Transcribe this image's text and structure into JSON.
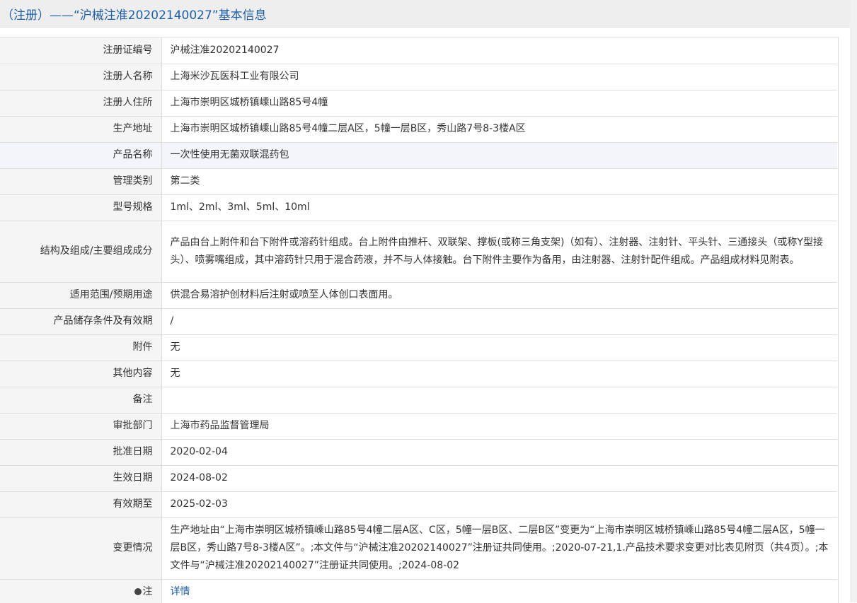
{
  "header": {
    "title": "（注册）——“沪械注准20202140027”基本信息"
  },
  "rows": [
    {
      "label": "注册证编号",
      "value": "沪械注准20202140027"
    },
    {
      "label": "注册人名称",
      "value": "上海米沙瓦医科工业有限公司"
    },
    {
      "label": "注册人住所",
      "value": "上海市崇明区城桥镇嵊山路85号4幢"
    },
    {
      "label": "生产地址",
      "value": "上海市崇明区城桥镇嵊山路85号4幢二层A区，5幢一层B区，秀山路7号8-3楼A区"
    },
    {
      "label": "产品名称",
      "value": "一次性使用无菌双联混药包"
    },
    {
      "label": "管理类别",
      "value": "第二类"
    },
    {
      "label": "型号规格",
      "value": "1ml、2ml、3ml、5ml、10ml"
    },
    {
      "label": "结构及组成/主要组成成分",
      "value": "产品由台上附件和台下附件或溶药针组成。台上附件由推杆、双联架、撑板(或称三角支架)（如有）、注射器、注射针、平头针、三通接头（或称Y型接头）、喷雾嘴组成，其中溶药针只用于混合药液，并不与人体接触。台下附件主要作为备用，由注射器、注射针配件组成。产品组成材料见附表。"
    },
    {
      "label": "适用范围/预期用途",
      "value": "供混合易溶护创材料后注射或喷至人体创口表面用。"
    },
    {
      "label": "产品储存条件及有效期",
      "value": "/"
    },
    {
      "label": "附件",
      "value": "无"
    },
    {
      "label": "其他内容",
      "value": "无"
    },
    {
      "label": "备注",
      "value": ""
    },
    {
      "label": "审批部门",
      "value": "上海市药品监督管理局"
    },
    {
      "label": "批准日期",
      "value": "2020-02-04"
    },
    {
      "label": "生效日期",
      "value": "2024-08-02"
    },
    {
      "label": "有效期至",
      "value": "2025-02-03"
    },
    {
      "label": "变更情况",
      "value": "生产地址由“上海市崇明区城桥镇嵊山路85号4幢二层A区、C区，5幢一层B区、二层B区”变更为“上海市崇明区城桥镇嵊山路85号4幢二层A区，5幢一层B区，秀山路7号8-3楼A区”。;本文件与“沪械注准20202140027”注册证共同使用。;2020-07-21,1.产品技术要求变更对比表见附页（共4页）。;本文件与“沪械注准20202140027”注册证共同使用。;2024-08-02"
    },
    {
      "label": "注",
      "value": "详情"
    }
  ]
}
